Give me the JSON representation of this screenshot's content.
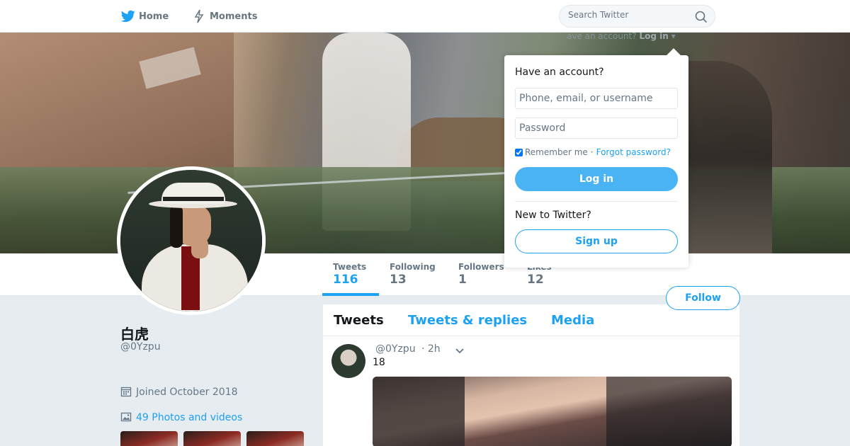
{
  "nav": {
    "home_label": "Home",
    "moments_label": "Moments",
    "search_placeholder": "Search Twitter",
    "home_icon": "twitter-bird-icon",
    "moments_icon": "lightning-icon",
    "search_icon": "magnifier-icon"
  },
  "top_login": {
    "prompt": "ave an account?",
    "link": "Log in"
  },
  "profile": {
    "name": "白虎",
    "handle": "@0Yzpu",
    "joined": "Joined October 2018",
    "photos_label": "49 Photos and videos",
    "follow_label": "Follow"
  },
  "stats": [
    {
      "label": "Tweets",
      "value": "116"
    },
    {
      "label": "Following",
      "value": "13"
    },
    {
      "label": "Followers",
      "value": "1"
    },
    {
      "label": "Likes",
      "value": "12"
    }
  ],
  "timeline": {
    "tabs": [
      "Tweets",
      "Tweets & replies",
      "Media"
    ],
    "tweet": {
      "handle": "@0Yzpu",
      "time": "· 2h",
      "text": "18"
    }
  },
  "login_popup": {
    "title": "Have an account?",
    "username_placeholder": "Phone, email, or username",
    "password_placeholder": "Password",
    "remember": "Remember me",
    "separator": "·",
    "forgot": "Forgot password?",
    "login_button": "Log in",
    "new_prompt": "New to Twitter?",
    "signup_button": "Sign up"
  },
  "colors": {
    "accent": "#1da1f2",
    "login_button": "#4ab3f4",
    "page_bg": "#e6ecf0"
  }
}
